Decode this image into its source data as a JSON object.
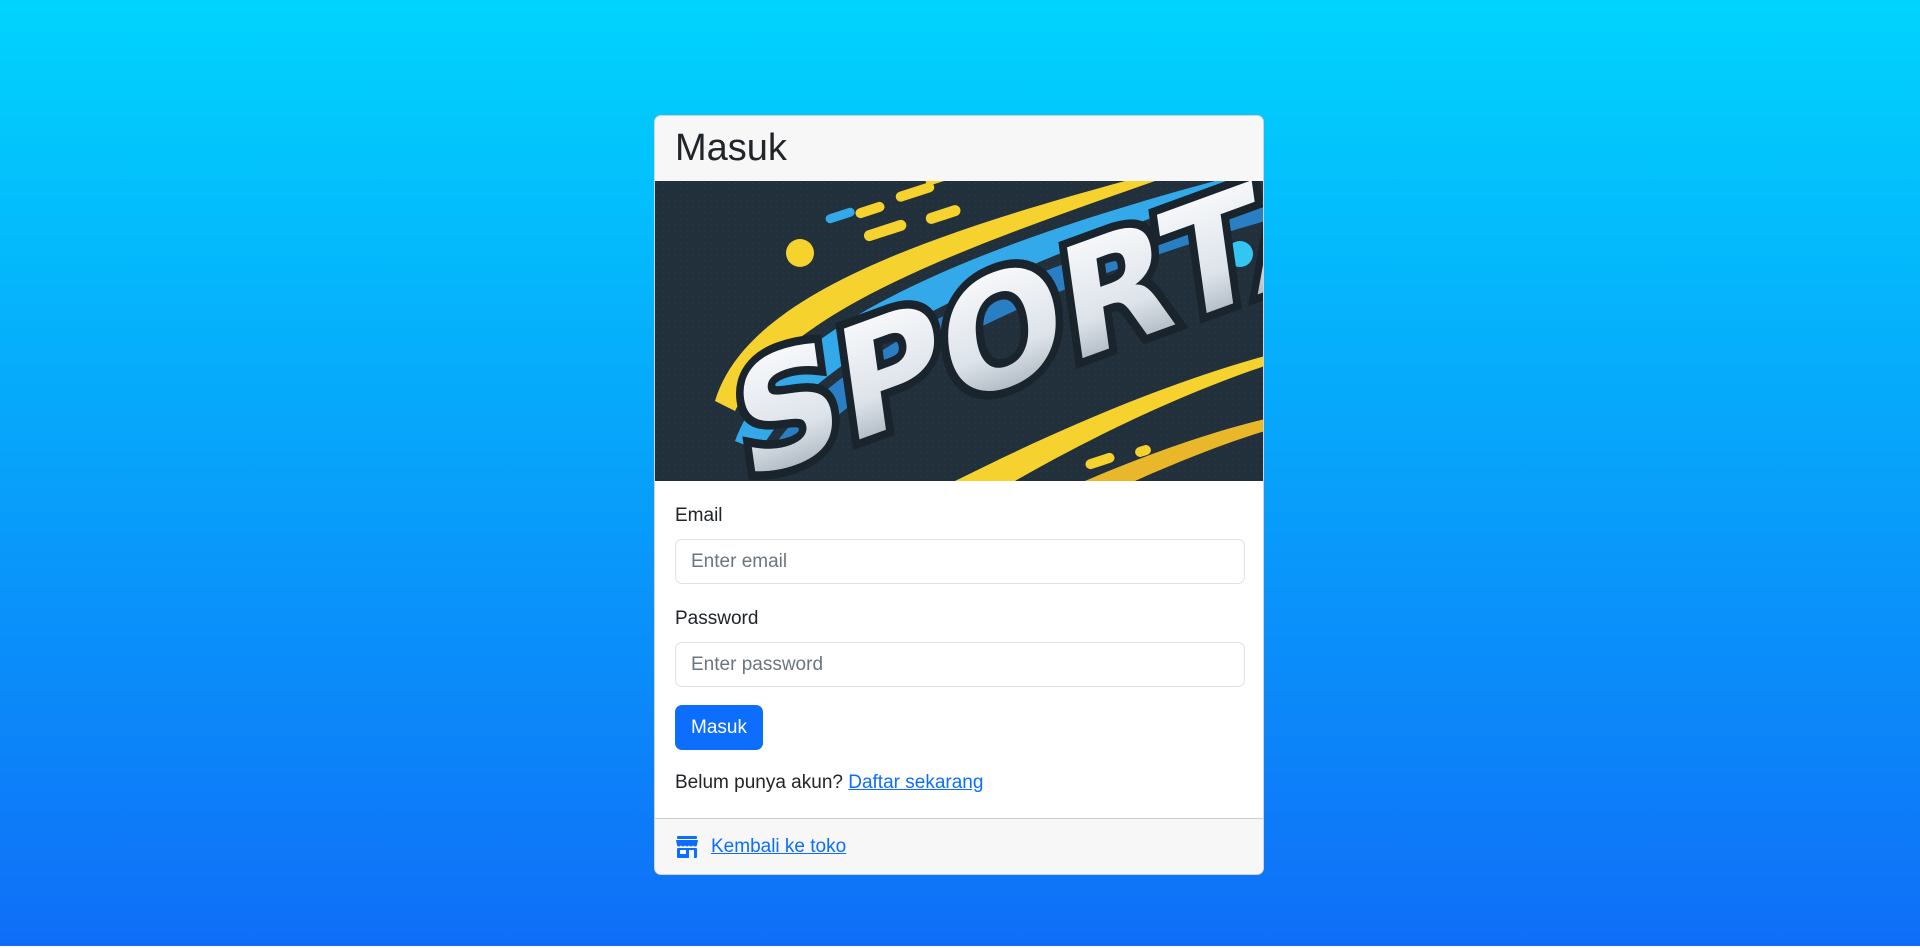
{
  "card": {
    "title": "Masuk",
    "banner": {
      "brand_text": "SPORTA"
    }
  },
  "form": {
    "email": {
      "label": "Email",
      "placeholder": "Enter email",
      "value": ""
    },
    "password": {
      "label": "Password",
      "placeholder": "Enter password",
      "value": ""
    },
    "submit_label": "Masuk"
  },
  "register": {
    "prompt": "Belum punya akun?",
    "link_label": "Daftar sekarang"
  },
  "footer": {
    "icon": "store-icon",
    "link_label": "Kembali ke toko"
  },
  "colors": {
    "background_top": "#00d4fd",
    "background_bottom": "#0f6ef8",
    "primary": "#0d6efd",
    "banner_dark": "#22303c",
    "banner_yellow": "#f6d22f",
    "banner_blue": "#33a9ea"
  }
}
